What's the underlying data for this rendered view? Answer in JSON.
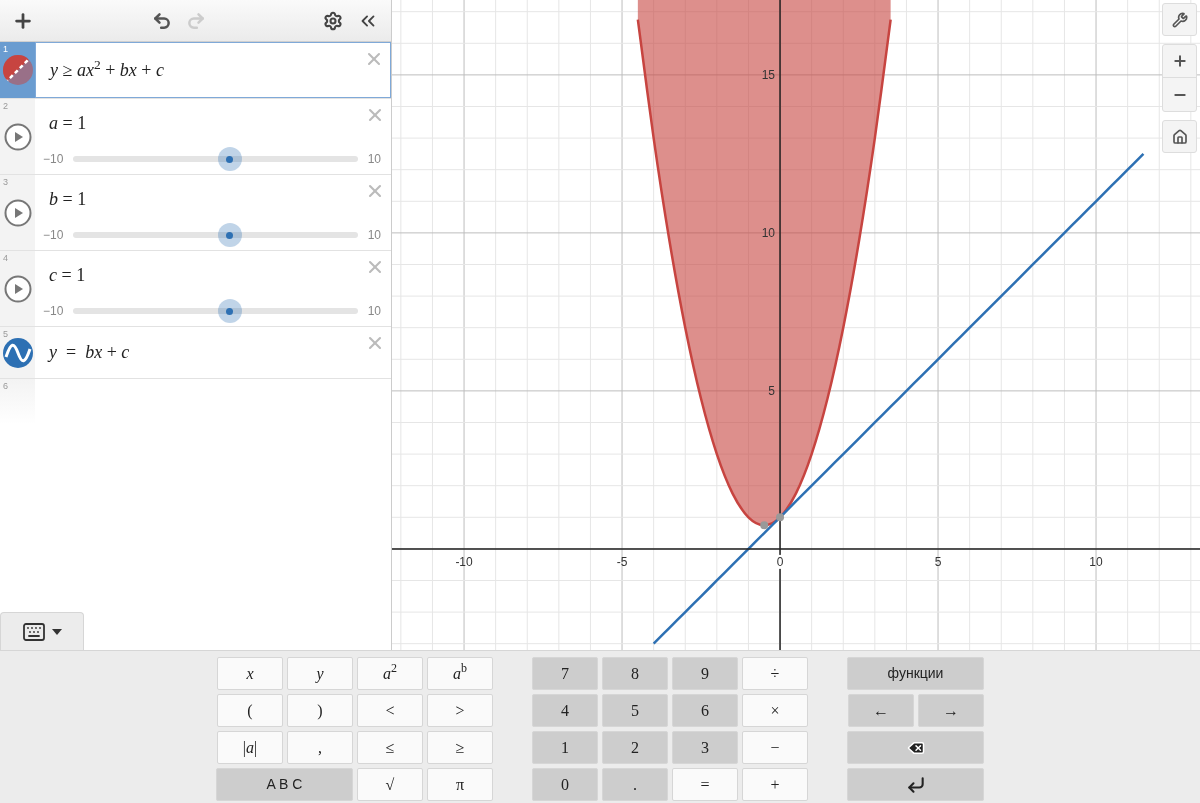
{
  "expressions": [
    {
      "kind": "inequality",
      "number": "1",
      "latex": "*y* ≥ *ax*$^{2}$ + *bx* + *c*",
      "selected": true,
      "color": "#c74440"
    },
    {
      "kind": "slider",
      "number": "2",
      "latex": "*a* = 1",
      "min": "−10",
      "max": "10",
      "level": 0.55,
      "selected": false
    },
    {
      "kind": "slider",
      "number": "3",
      "latex": "*b* = 1",
      "min": "−10",
      "max": "10",
      "level": 0.55,
      "selected": false
    },
    {
      "kind": "slider",
      "number": "4",
      "latex": "*c* = 1",
      "min": "−10",
      "max": "10",
      "level": 0.55,
      "selected": false
    },
    {
      "kind": "function",
      "number": "5",
      "latex": "*y*  =  *bx* + *c*",
      "selected": false,
      "color": "#2d70b3"
    },
    {
      "kind": "empty",
      "number": "6",
      "selected": false
    }
  ],
  "graph": {
    "chart_data": {
      "type": "line",
      "xlim": [
        -12.28,
        13.29
      ],
      "ylim": [
        -3.2,
        17.37
      ],
      "xticks": [
        -10,
        -5,
        0,
        5,
        10
      ],
      "yticks": [
        5,
        10,
        15
      ],
      "x": [
        -4.5,
        -4,
        -3.5,
        -3,
        -2.5,
        -2,
        -1.5,
        -1,
        -0.5,
        0,
        0.5,
        1,
        1.5,
        2,
        2.5,
        3,
        3.5,
        4,
        4.5,
        5,
        5.5,
        6,
        6.5,
        7,
        7.5,
        8,
        8.5,
        9,
        9.5,
        10,
        10.5,
        11,
        11.5
      ],
      "series": [
        {
          "color": "#c74440",
          "values": [
            16.75,
            13,
            9.75,
            7,
            4.75,
            3,
            1.75,
            1,
            0.75,
            1,
            1.75,
            3,
            4.75,
            7,
            9.75,
            13,
            16.75,
            null,
            null,
            null,
            null,
            null,
            null,
            null,
            null,
            null,
            null,
            null,
            null,
            null,
            null,
            null,
            null
          ]
        },
        {
          "color": "#2d70b3",
          "values": [
            null,
            -3,
            -2.5,
            -2,
            -1.5,
            -1,
            -0.5,
            0,
            0.5,
            1,
            1.5,
            2,
            2.5,
            3,
            3.5,
            4,
            4.5,
            5,
            5.5,
            6,
            6.5,
            7,
            7.5,
            8,
            8.5,
            9,
            9.5,
            10,
            10.5,
            11,
            11.5,
            12,
            12.5
          ]
        }
      ],
      "grid": true
    }
  },
  "keypad": {
    "groups": [
      {
        "rows": [
          [
            {
              "kind": "light",
              "label": "*x*"
            },
            {
              "kind": "light",
              "label": "*y*"
            },
            {
              "kind": "light",
              "label": "*a*$^{2}$"
            },
            {
              "kind": "light",
              "label": "*a*$^{b}$"
            }
          ],
          [
            {
              "kind": "light",
              "label": "("
            },
            {
              "kind": "light",
              "label": ")"
            },
            {
              "kind": "light",
              "label": "<"
            },
            {
              "kind": "light",
              "label": ">"
            }
          ],
          [
            {
              "kind": "light",
              "label": "|*a*|"
            },
            {
              "kind": "light",
              "label": ","
            },
            {
              "kind": "light",
              "label": "≤"
            },
            {
              "kind": "light",
              "label": "≥"
            }
          ],
          [
            {
              "kind": "wide",
              "label": "A B C"
            },
            "",
            {
              "kind": "light",
              "label": "√"
            },
            {
              "kind": "light",
              "label": "π"
            }
          ]
        ]
      },
      {
        "rows": [
          [
            {
              "kind": "dark",
              "label": "7"
            },
            {
              "kind": "dark",
              "label": "8"
            },
            {
              "kind": "dark",
              "label": "9"
            },
            {
              "kind": "light",
              "label": "÷"
            }
          ],
          [
            {
              "kind": "dark",
              "label": "4"
            },
            {
              "kind": "dark",
              "label": "5"
            },
            {
              "kind": "dark",
              "label": "6"
            },
            {
              "kind": "light",
              "label": "×"
            }
          ],
          [
            {
              "kind": "dark",
              "label": "1"
            },
            {
              "kind": "dark",
              "label": "2"
            },
            {
              "kind": "dark",
              "label": "3"
            },
            {
              "kind": "light",
              "label": "−"
            }
          ],
          [
            {
              "kind": "dark",
              "label": "0"
            },
            {
              "kind": "dark",
              "label": "."
            },
            {
              "kind": "light",
              "label": "="
            },
            {
              "kind": "light",
              "label": "+"
            }
          ]
        ]
      },
      {
        "rows": [
          [
            {
              "kind": "wide",
              "label": "функции"
            }
          ],
          [
            {
              "kind": "dark",
              "label": "←"
            },
            {
              "kind": "dark",
              "label": "→"
            }
          ],
          [
            {
              "kind": "backspace"
            }
          ],
          [
            {
              "kind": "enter"
            }
          ]
        ]
      }
    ]
  },
  "keyboard_toggle": {
    "expanded": true
  }
}
